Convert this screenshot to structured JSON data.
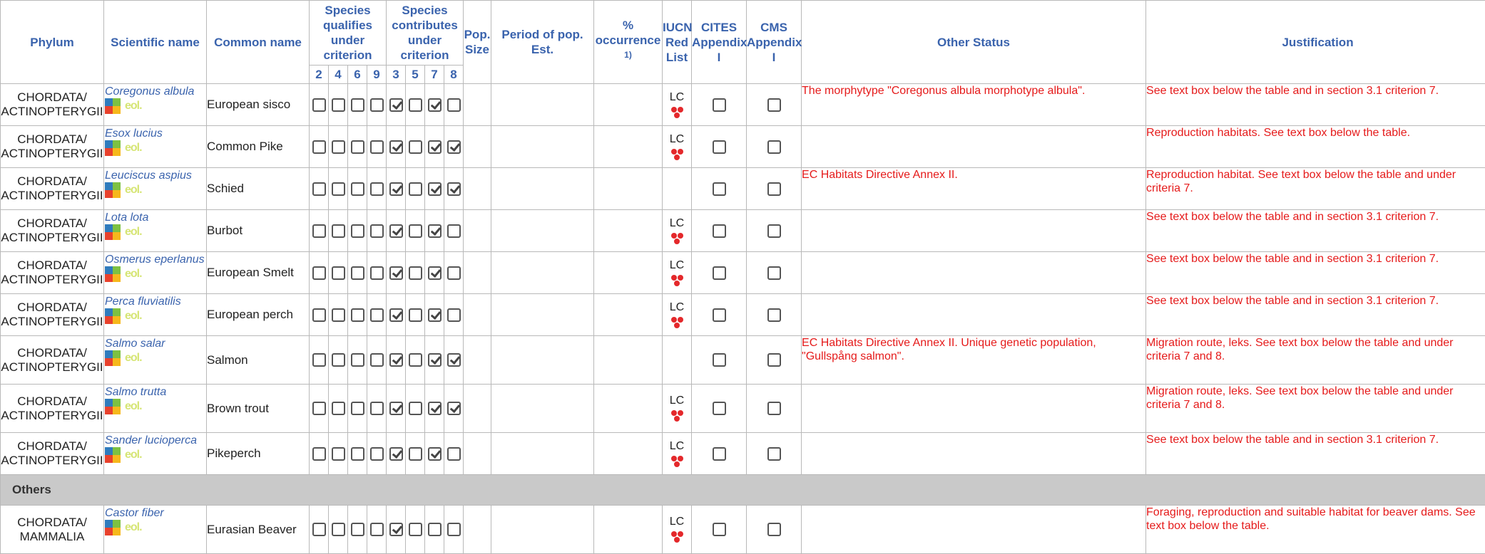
{
  "headers": {
    "phylum": "Phylum",
    "scientific_name": "Scientific name",
    "common_name": "Common name",
    "qualifies": "Species qualifies under criterion",
    "contributes": "Species contributes under criterion",
    "pop_size": "Pop. Size",
    "period": "Period of pop. Est.",
    "occurrence": "% occurrence",
    "occurrence_note": "1)",
    "iucn": "IUCN Red List",
    "cites": "CITES Appendix I",
    "cms": "CMS Appendix I",
    "other_status": "Other Status",
    "justification": "Justification",
    "qualifies_nums": [
      "2",
      "4",
      "6",
      "9"
    ],
    "contributes_nums": [
      "3",
      "5",
      "7",
      "8"
    ]
  },
  "icon_text": {
    "eol": "eol.",
    "iucn": "LC"
  },
  "colors": {
    "header_text": "#3a63ad",
    "status_text": "#e51a1a",
    "group_bg": "#c9c9c9"
  },
  "rows": [
    {
      "phylum1": "CHORDATA/",
      "phylum2": "ACTINOPTERYGII",
      "scientific": "Coregonus albula",
      "common": "European sisco",
      "checks": [
        false,
        false,
        false,
        false,
        true,
        false,
        true,
        false
      ],
      "iucn": "LC",
      "other_status": "The morphytype \"Coregonus albula morphotype albula\".",
      "justification": "See text box below the table and in section 3.1 criterion 7."
    },
    {
      "phylum1": "CHORDATA/",
      "phylum2": "ACTINOPTERYGII",
      "scientific": "Esox lucius",
      "common": "Common Pike",
      "checks": [
        false,
        false,
        false,
        false,
        true,
        false,
        true,
        true
      ],
      "iucn": "LC",
      "other_status": "",
      "justification": "Reproduction habitats. See text box below the table."
    },
    {
      "phylum1": "CHORDATA/",
      "phylum2": "ACTINOPTERYGII",
      "scientific": "Leuciscus aspius",
      "common": "Schied",
      "checks": [
        false,
        false,
        false,
        false,
        true,
        false,
        true,
        true
      ],
      "iucn": "",
      "other_status": "EC Habitats Directive Annex II.",
      "justification": "Reproduction habitat. See text box below the table and under criteria 7."
    },
    {
      "phylum1": "CHORDATA/",
      "phylum2": "ACTINOPTERYGII",
      "scientific": "Lota lota",
      "common": "Burbot",
      "checks": [
        false,
        false,
        false,
        false,
        true,
        false,
        true,
        false
      ],
      "iucn": "LC",
      "other_status": "",
      "justification": "See text box below the table and in section 3.1 criterion 7."
    },
    {
      "phylum1": "CHORDATA/",
      "phylum2": "ACTINOPTERYGII",
      "scientific": "Osmerus eperlanus",
      "common": "European Smelt",
      "checks": [
        false,
        false,
        false,
        false,
        true,
        false,
        true,
        false
      ],
      "iucn": "LC",
      "other_status": "",
      "justification": "See text box below the table and in section 3.1 criterion 7."
    },
    {
      "phylum1": "CHORDATA/",
      "phylum2": "ACTINOPTERYGII",
      "scientific": "Perca fluviatilis",
      "common": "European perch",
      "checks": [
        false,
        false,
        false,
        false,
        true,
        false,
        true,
        false
      ],
      "iucn": "LC",
      "other_status": "",
      "justification": "See text box below the table and in section 3.1 criterion 7."
    },
    {
      "phylum1": "CHORDATA/",
      "phylum2": "ACTINOPTERYGII",
      "scientific": "Salmo salar",
      "common": "Salmon",
      "checks": [
        false,
        false,
        false,
        false,
        true,
        false,
        true,
        true
      ],
      "iucn": "",
      "other_status": "EC Habitats Directive Annex II. Unique genetic population, \"Gullspång salmon\".",
      "justification": "Migration route, leks. See text box below the table and under criteria 7 and 8."
    },
    {
      "phylum1": "CHORDATA/",
      "phylum2": "ACTINOPTERYGII",
      "scientific": "Salmo trutta",
      "common": "Brown trout",
      "checks": [
        false,
        false,
        false,
        false,
        true,
        false,
        true,
        true
      ],
      "iucn": "LC",
      "other_status": "",
      "justification": "Migration route, leks. See text box below the table and under criteria 7 and 8."
    },
    {
      "phylum1": "CHORDATA/",
      "phylum2": "ACTINOPTERYGII",
      "scientific": "Sander lucioperca",
      "common": "Pikeperch",
      "checks": [
        false,
        false,
        false,
        false,
        true,
        false,
        true,
        false
      ],
      "iucn": "LC",
      "other_status": "",
      "justification": "See text box below the table and in section 3.1 criterion 7."
    }
  ],
  "group_label": "Others",
  "others": [
    {
      "phylum1": "CHORDATA/",
      "phylum2": "MAMMALIA",
      "scientific": "Castor fiber",
      "common": "Eurasian Beaver",
      "checks": [
        false,
        false,
        false,
        false,
        true,
        false,
        false,
        false
      ],
      "iucn": "LC",
      "other_status": "",
      "justification": "Foraging, reproduction and suitable habitat for beaver dams. See text box below the table."
    }
  ]
}
